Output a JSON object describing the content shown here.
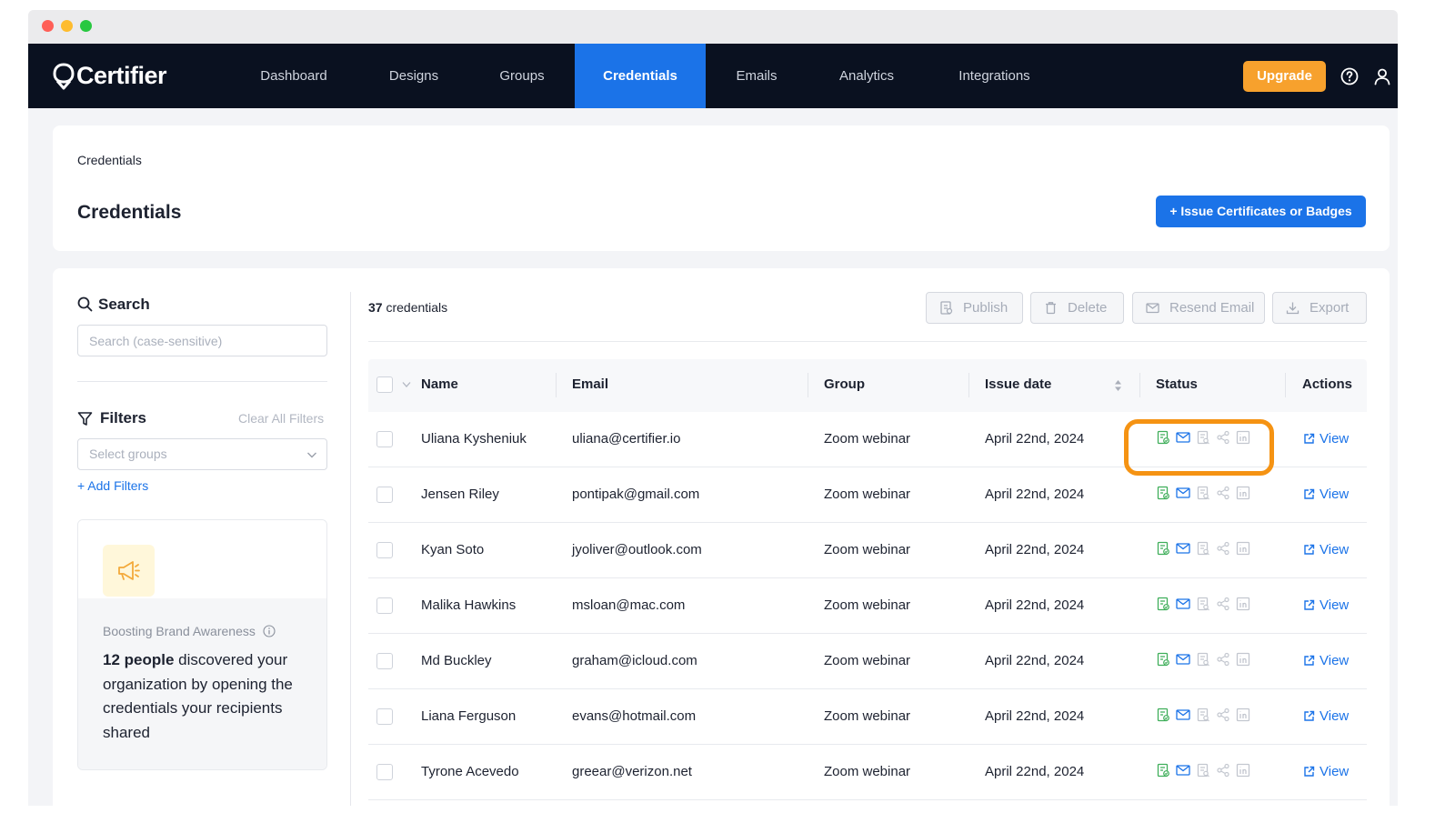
{
  "nav": {
    "brand": "Certifier",
    "items": [
      {
        "label": "Dashboard",
        "active": false
      },
      {
        "label": "Designs",
        "active": false
      },
      {
        "label": "Groups",
        "active": false
      },
      {
        "label": "Credentials",
        "active": true
      },
      {
        "label": "Emails",
        "active": false
      },
      {
        "label": "Analytics",
        "active": false
      },
      {
        "label": "Integrations",
        "active": false
      }
    ],
    "upgrade_label": "Upgrade",
    "help_icon": "question-circle-icon",
    "user_icon": "user-icon"
  },
  "header": {
    "breadcrumb": "Credentials",
    "title": "Credentials",
    "issue_button": "+ Issue Certificates or Badges"
  },
  "sidebar": {
    "search_label": "Search",
    "search_placeholder": "Search (case-sensitive)",
    "filters_label": "Filters",
    "clear_filters": "Clear All Filters",
    "select_groups_placeholder": "Select groups",
    "add_filters": "+ Add Filters",
    "promo": {
      "caption": "Boosting Brand Awareness",
      "highlight": "12 people",
      "text": " discovered your organization by opening the credentials your recipients shared"
    }
  },
  "toolbar": {
    "count_number": "37",
    "count_label": " credentials",
    "publish": "Publish",
    "delete": "Delete",
    "resend": "Resend Email",
    "export": "Export"
  },
  "table": {
    "columns": {
      "name": "Name",
      "email": "Email",
      "group": "Group",
      "issue_date": "Issue date",
      "status": "Status",
      "actions": "Actions"
    },
    "view_label": "View",
    "rows": [
      {
        "name": "Uliana Kysheniuk",
        "email": "uliana@certifier.io",
        "group": "Zoom webinar",
        "date": "April 22nd, 2024"
      },
      {
        "name": "Jensen Riley",
        "email": "pontipak@gmail.com",
        "group": "Zoom webinar",
        "date": "April 22nd, 2024"
      },
      {
        "name": "Kyan Soto",
        "email": "jyoliver@outlook.com",
        "group": "Zoom webinar",
        "date": "April 22nd, 2024"
      },
      {
        "name": "Malika Hawkins",
        "email": "msloan@mac.com",
        "group": "Zoom webinar",
        "date": "April 22nd, 2024"
      },
      {
        "name": "Md Buckley",
        "email": "graham@icloud.com",
        "group": "Zoom webinar",
        "date": "April 22nd, 2024"
      },
      {
        "name": "Liana Ferguson",
        "email": "evans@hotmail.com",
        "group": "Zoom webinar",
        "date": "April 22nd, 2024"
      },
      {
        "name": "Tyrone Acevedo",
        "email": "greear@verizon.net",
        "group": "Zoom webinar",
        "date": "April 22nd, 2024"
      }
    ]
  },
  "colors": {
    "nav_bg": "#0a1120",
    "accent": "#1b73e8",
    "upgrade": "#f7a12d",
    "highlight": "#f59313",
    "status_green": "#3fae5a"
  }
}
